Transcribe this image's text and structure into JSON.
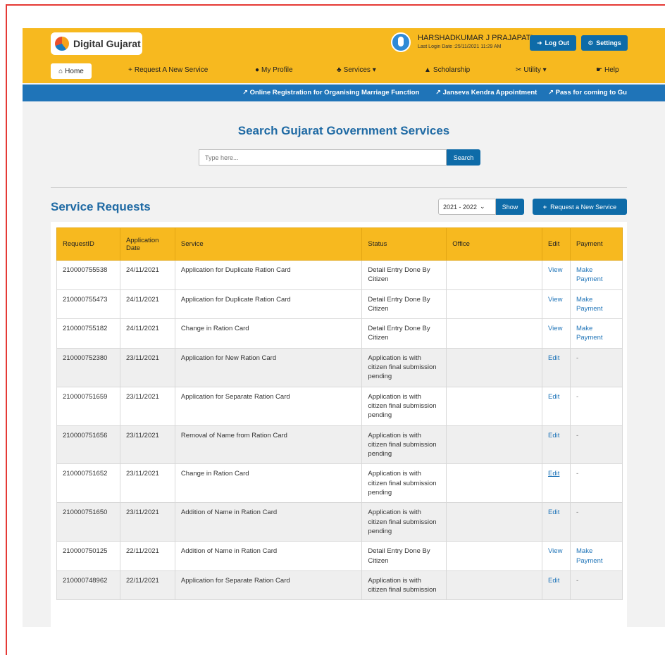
{
  "header": {
    "logo_text": "Digital Gujarat",
    "user_name": "HARSHADKUMAR J PRAJAPATI",
    "last_login": "Last Login Date :25/11/2021 11:29 AM",
    "logout_label": "Log Out",
    "settings_label": "Settings"
  },
  "nav": {
    "home": "Home",
    "request_new": "Request A New Service",
    "my_profile": "My Profile",
    "services": "Services",
    "scholarship": "Scholarship",
    "utility": "Utility",
    "help": "Help"
  },
  "ticker": [
    "Online Registration for Organising Marriage Function",
    "Janseva Kendra Appointment",
    "Pass for coming to Gu"
  ],
  "search": {
    "title": "Search Gujarat Government Services",
    "placeholder": "Type here...",
    "button_label": "Search"
  },
  "service_requests": {
    "title": "Service Requests",
    "year": "2021 - 2022",
    "show_label": "Show",
    "new_request_label": "Request a New Service",
    "columns": [
      "RequestID",
      "Application Date",
      "Service",
      "Status",
      "Office",
      "Edit",
      "Payment"
    ],
    "rows": [
      {
        "id": "210000755538",
        "date": "24/11/2021",
        "service": "Application for Duplicate Ration Card",
        "status": "Detail Entry Done By Citizen",
        "office": "",
        "edit": "View",
        "payment": "Make Payment"
      },
      {
        "id": "210000755473",
        "date": "24/11/2021",
        "service": "Application for Duplicate Ration Card",
        "status": "Detail Entry Done By Citizen",
        "office": "",
        "edit": "View",
        "payment": "Make Payment"
      },
      {
        "id": "210000755182",
        "date": "24/11/2021",
        "service": "Change in Ration Card",
        "status": "Detail Entry Done By Citizen",
        "office": "",
        "edit": "View",
        "payment": "Make Payment"
      },
      {
        "id": "210000752380",
        "date": "23/11/2021",
        "service": "Application for New Ration Card",
        "status": "Application is with citizen final submission pending",
        "office": "",
        "edit": "Edit",
        "payment": "-"
      },
      {
        "id": "210000751659",
        "date": "23/11/2021",
        "service": "Application for Separate Ration Card",
        "status": "Application is with citizen final submission pending",
        "office": "",
        "edit": "Edit",
        "payment": "-"
      },
      {
        "id": "210000751656",
        "date": "23/11/2021",
        "service": "Removal of Name from Ration Card",
        "status": "Application is with citizen final submission pending",
        "office": "",
        "edit": "Edit",
        "payment": "-"
      },
      {
        "id": "210000751652",
        "date": "23/11/2021",
        "service": "Change in Ration Card",
        "status": "Application is with citizen final submission pending",
        "office": "",
        "edit": "Edit",
        "payment": "-"
      },
      {
        "id": "210000751650",
        "date": "23/11/2021",
        "service": "Addition of Name in Ration Card",
        "status": "Application is with citizen final submission pending",
        "office": "",
        "edit": "Edit",
        "payment": "-"
      },
      {
        "id": "210000750125",
        "date": "22/11/2021",
        "service": "Addition of Name in Ration Card",
        "status": "Detail Entry Done By Citizen",
        "office": "",
        "edit": "View",
        "payment": "Make Payment"
      },
      {
        "id": "210000748962",
        "date": "22/11/2021",
        "service": "Application for Separate Ration Card",
        "status": "Application is with citizen final submission",
        "office": "",
        "edit": "Edit",
        "payment": "-"
      }
    ]
  },
  "colors": {
    "header_yellow": "#f7b91f",
    "primary_blue": "#0e6ba8",
    "ticker_blue": "#1f74b8",
    "frame_red": "#e53935"
  }
}
